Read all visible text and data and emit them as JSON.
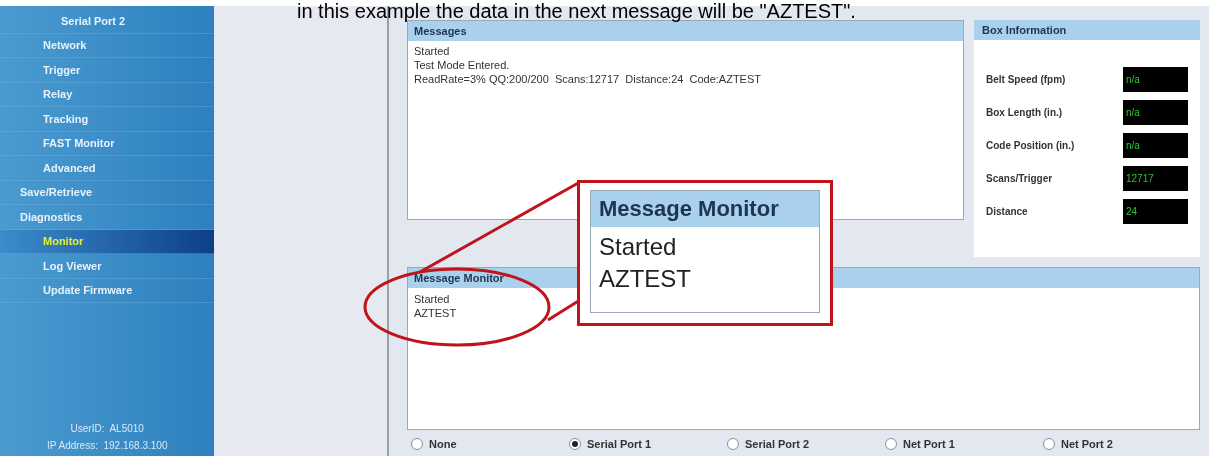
{
  "caption": "in this example the data in the next message will be \"AZTEST\".",
  "sidebar": {
    "items": [
      {
        "children": [
          {
            "children": [
              {
                "label": "Serial Port 2",
                "selected": false
              }
            ]
          },
          {
            "label": "Network",
            "selected": false
          },
          {
            "label": "Trigger",
            "selected": false
          },
          {
            "label": "Relay",
            "selected": false
          },
          {
            "label": "Tracking",
            "selected": false
          },
          {
            "label": "FAST Monitor",
            "selected": false
          },
          {
            "label": "Advanced",
            "selected": false
          }
        ]
      },
      {
        "label": "Save/Retrieve",
        "selected": false
      },
      {
        "label": "Diagnostics",
        "selected": false,
        "children": [
          {
            "label": "Monitor",
            "selected": true
          },
          {
            "label": "Log Viewer",
            "selected": false
          },
          {
            "label": "Update Firmware",
            "selected": false
          }
        ]
      }
    ],
    "info": [
      "UserID:  AL5010",
      "IP Address:  192.168.3.100"
    ]
  },
  "messages": {
    "title": "Messages",
    "lines": [
      "Started",
      "Test Mode Entered.",
      "ReadRate=3% QQ:200/200  Scans:12717  Distance:24  Code:AZTEST"
    ]
  },
  "box_information": {
    "title": "Box Information",
    "fields": [
      {
        "label": "Belt Speed (fpm)",
        "value": "n/a"
      },
      {
        "label": "Box Length (in.)",
        "value": "n/a"
      },
      {
        "label": "Code Position (in.)",
        "value": "n/a"
      },
      {
        "label": "Scans/Trigger",
        "value": "12717"
      },
      {
        "label": "Distance",
        "value": "24"
      }
    ]
  },
  "message_monitor": {
    "title": "Message Monitor",
    "lines": [
      "Started",
      "AZTEST"
    ]
  },
  "callout": {
    "title": "Message Monitor",
    "lines": [
      "Started",
      "AZTEST"
    ]
  },
  "ports": [
    {
      "label": "None",
      "selected": false
    },
    {
      "label": "Serial Port 1",
      "selected": true
    },
    {
      "label": "Serial Port 2",
      "selected": false
    },
    {
      "label": "Net Port 1",
      "selected": false
    },
    {
      "label": "Net Port 2",
      "selected": false
    }
  ]
}
